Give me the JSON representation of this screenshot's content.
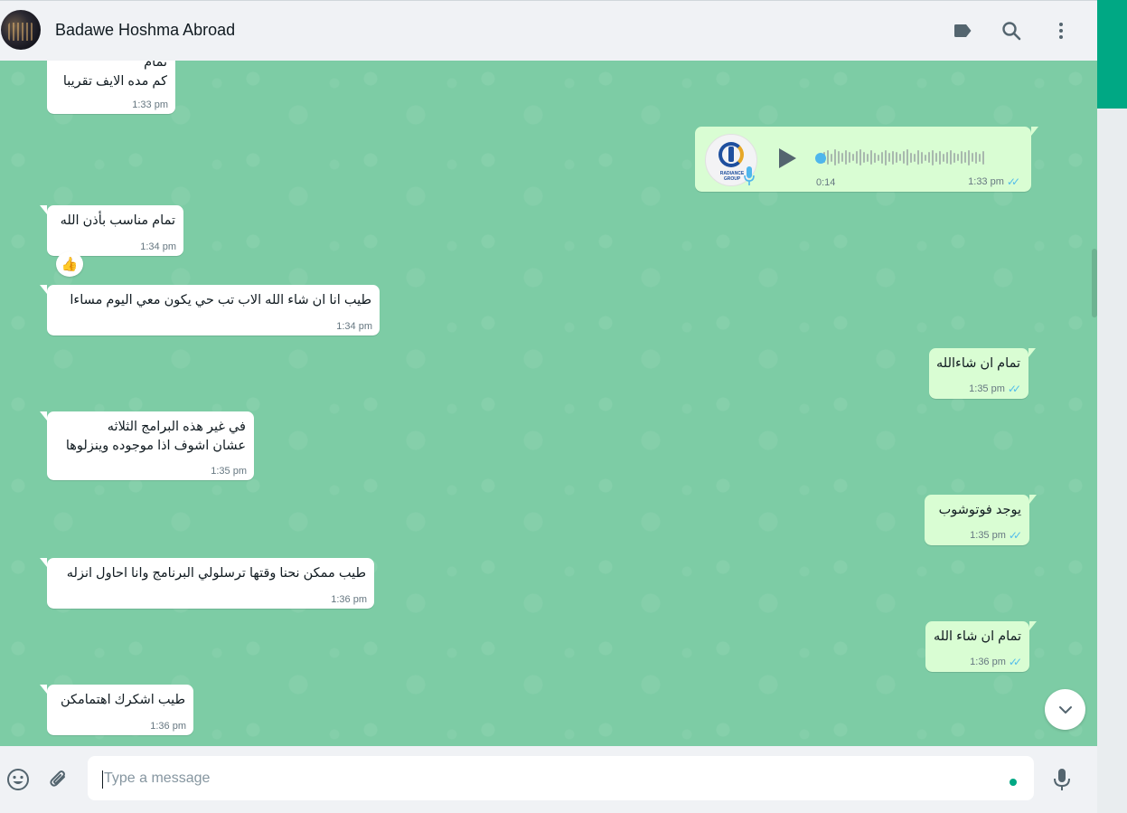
{
  "header": {
    "contact_name": "Badawe Hoshma Abroad",
    "icons": [
      "label-icon",
      "search-icon",
      "menu-icon"
    ]
  },
  "messages": [
    {
      "direction": "in",
      "text_lines": [
        "تمام",
        "كم مده الايف تقريبا"
      ],
      "time": "1:33 pm"
    },
    {
      "direction": "out",
      "type": "voice",
      "duration": "0:14",
      "time": "1:33 pm",
      "sender_avatar_text": [
        "RADIANCE",
        "GROUP"
      ]
    },
    {
      "direction": "in",
      "text_lines": [
        "تمام مناسب بأذن الله"
      ],
      "time": "1:34 pm",
      "reaction": "👍"
    },
    {
      "direction": "in",
      "text_lines": [
        "طيب انا ان شاء الله الاب تب حي يكون معي اليوم مساءا"
      ],
      "time": "1:34 pm"
    },
    {
      "direction": "out",
      "text_lines": [
        "تمام ان شاءالله"
      ],
      "time": "1:35 pm"
    },
    {
      "direction": "in",
      "text_lines": [
        "في غير هذه البرامج الثلاثه",
        "عشان اشوف اذا موجوده وينزلوها"
      ],
      "time": "1:35 pm"
    },
    {
      "direction": "out",
      "text_lines": [
        "يوجد فوتوشوب"
      ],
      "time": "1:35 pm"
    },
    {
      "direction": "in",
      "text_lines": [
        "طيب ممكن نحنا وقتها ترسلولي البرنامج وانا احاول انزله"
      ],
      "time": "1:36 pm"
    },
    {
      "direction": "out",
      "text_lines": [
        "تمام ان شاء الله"
      ],
      "time": "1:36 pm"
    },
    {
      "direction": "in",
      "text_lines": [
        "طيب اشكرك اهتمامكن"
      ],
      "time": "1:36 pm"
    }
  ],
  "composer": {
    "placeholder": "Type a message",
    "icons": [
      "emoji-icon",
      "attach-icon",
      "mic-icon"
    ]
  },
  "colors": {
    "chat_background": "#7dcca5",
    "incoming_bubble": "#ffffff",
    "outgoing_bubble": "#d9fdd3",
    "accent": "#00a884",
    "read_ticks": "#53bdeb"
  }
}
